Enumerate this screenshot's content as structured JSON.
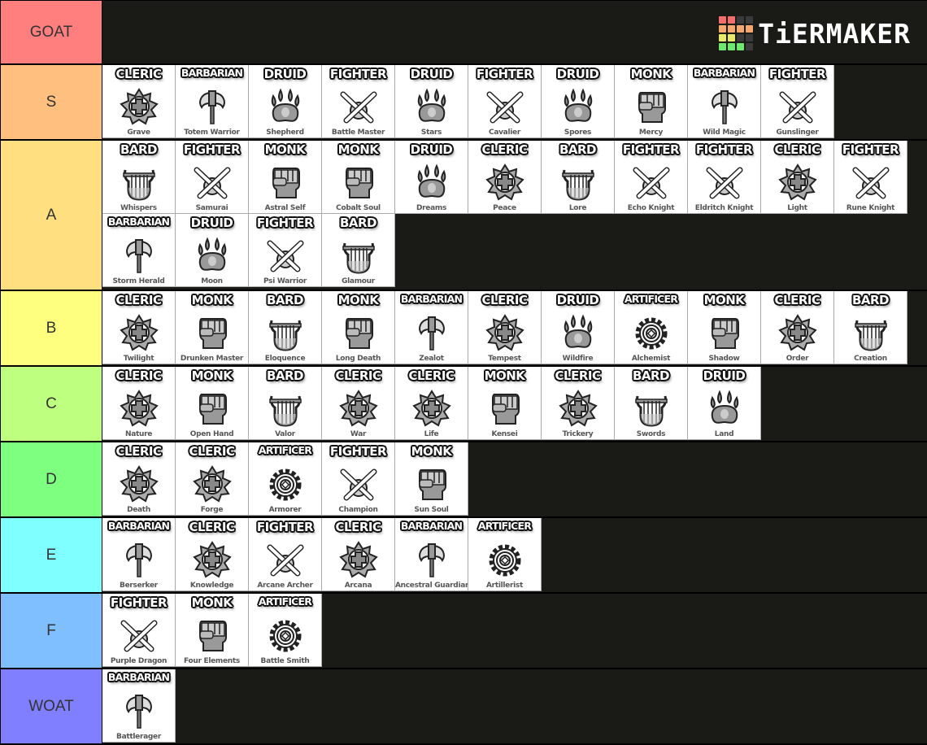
{
  "brand": {
    "name": "TiERMAKER",
    "logo_grid": [
      "#f56e6e",
      "#f56e6e",
      "#3a3a3a",
      "#3a3a3a",
      "#f5a86e",
      "#f5a86e",
      "#f5a86e",
      "#f5a86e",
      "#e8e86a",
      "#e8e86a",
      "#3a3a3a",
      "#3a3a3a",
      "#6ee86e",
      "#6ee86e",
      "#6ee86e",
      "#3a3a3a"
    ]
  },
  "icons": {
    "CLERIC": "cleric-holy-symbol-icon",
    "BARBARIAN": "barbarian-axe-icon",
    "DRUID": "druid-paw-icon",
    "FIGHTER": "fighter-crossed-swords-icon",
    "MONK": "monk-fist-icon",
    "BARD": "bard-lyre-icon",
    "ARTIFICER": "artificer-gear-icon"
  },
  "tiers": [
    {
      "label": "GOAT",
      "color": "#ff7f7f",
      "items": []
    },
    {
      "label": "S",
      "color": "#ffbf7f",
      "items": [
        {
          "class": "CLERIC",
          "subclass": "Grave"
        },
        {
          "class": "BARBARIAN",
          "subclass": "Totem Warrior"
        },
        {
          "class": "DRUID",
          "subclass": "Shepherd"
        },
        {
          "class": "FIGHTER",
          "subclass": "Battle Master"
        },
        {
          "class": "DRUID",
          "subclass": "Stars"
        },
        {
          "class": "FIGHTER",
          "subclass": "Cavalier"
        },
        {
          "class": "DRUID",
          "subclass": "Spores"
        },
        {
          "class": "MONK",
          "subclass": "Mercy"
        },
        {
          "class": "BARBARIAN",
          "subclass": "Wild Magic"
        },
        {
          "class": "FIGHTER",
          "subclass": "Gunslinger"
        }
      ]
    },
    {
      "label": "A",
      "color": "#ffdf7f",
      "items": [
        {
          "class": "BARD",
          "subclass": "Whispers"
        },
        {
          "class": "FIGHTER",
          "subclass": "Samurai"
        },
        {
          "class": "MONK",
          "subclass": "Astral Self"
        },
        {
          "class": "MONK",
          "subclass": "Cobalt Soul"
        },
        {
          "class": "DRUID",
          "subclass": "Dreams"
        },
        {
          "class": "CLERIC",
          "subclass": "Peace"
        },
        {
          "class": "BARD",
          "subclass": "Lore"
        },
        {
          "class": "FIGHTER",
          "subclass": "Echo Knight"
        },
        {
          "class": "FIGHTER",
          "subclass": "Eldritch Knight"
        },
        {
          "class": "CLERIC",
          "subclass": "Light"
        },
        {
          "class": "FIGHTER",
          "subclass": "Rune Knight"
        },
        {
          "class": "BARBARIAN",
          "subclass": "Storm Herald"
        },
        {
          "class": "DRUID",
          "subclass": "Moon"
        },
        {
          "class": "FIGHTER",
          "subclass": "Psi Warrior"
        },
        {
          "class": "BARD",
          "subclass": "Glamour"
        }
      ]
    },
    {
      "label": "B",
      "color": "#ffff7f",
      "items": [
        {
          "class": "CLERIC",
          "subclass": "Twilight"
        },
        {
          "class": "MONK",
          "subclass": "Drunken Master"
        },
        {
          "class": "BARD",
          "subclass": "Eloquence"
        },
        {
          "class": "MONK",
          "subclass": "Long Death"
        },
        {
          "class": "BARBARIAN",
          "subclass": "Zealot"
        },
        {
          "class": "CLERIC",
          "subclass": "Tempest"
        },
        {
          "class": "DRUID",
          "subclass": "Wildfire"
        },
        {
          "class": "ARTIFICER",
          "subclass": "Alchemist"
        },
        {
          "class": "MONK",
          "subclass": "Shadow"
        },
        {
          "class": "CLERIC",
          "subclass": "Order"
        },
        {
          "class": "BARD",
          "subclass": "Creation"
        }
      ]
    },
    {
      "label": "C",
      "color": "#bfff7f",
      "items": [
        {
          "class": "CLERIC",
          "subclass": "Nature"
        },
        {
          "class": "MONK",
          "subclass": "Open Hand"
        },
        {
          "class": "BARD",
          "subclass": "Valor"
        },
        {
          "class": "CLERIC",
          "subclass": "War"
        },
        {
          "class": "CLERIC",
          "subclass": "Life"
        },
        {
          "class": "MONK",
          "subclass": "Kensei"
        },
        {
          "class": "CLERIC",
          "subclass": "Trickery"
        },
        {
          "class": "BARD",
          "subclass": "Swords"
        },
        {
          "class": "DRUID",
          "subclass": "Land"
        }
      ]
    },
    {
      "label": "D",
      "color": "#7fff7f",
      "items": [
        {
          "class": "CLERIC",
          "subclass": "Death"
        },
        {
          "class": "CLERIC",
          "subclass": "Forge"
        },
        {
          "class": "ARTIFICER",
          "subclass": "Armorer"
        },
        {
          "class": "FIGHTER",
          "subclass": "Champion"
        },
        {
          "class": "MONK",
          "subclass": "Sun Soul"
        }
      ]
    },
    {
      "label": "E",
      "color": "#7fffff",
      "items": [
        {
          "class": "BARBARIAN",
          "subclass": "Berserker"
        },
        {
          "class": "CLERIC",
          "subclass": "Knowledge"
        },
        {
          "class": "FIGHTER",
          "subclass": "Arcane Archer"
        },
        {
          "class": "CLERIC",
          "subclass": "Arcana"
        },
        {
          "class": "BARBARIAN",
          "subclass": "Ancestral Guardian"
        },
        {
          "class": "ARTIFICER",
          "subclass": "Artillerist"
        }
      ]
    },
    {
      "label": "F",
      "color": "#7fbfff",
      "items": [
        {
          "class": "FIGHTER",
          "subclass": "Purple Dragon"
        },
        {
          "class": "MONK",
          "subclass": "Four Elements"
        },
        {
          "class": "ARTIFICER",
          "subclass": "Battle Smith"
        }
      ]
    },
    {
      "label": "WOAT",
      "color": "#7f7fff",
      "items": [
        {
          "class": "BARBARIAN",
          "subclass": "Battlerager"
        }
      ]
    }
  ]
}
